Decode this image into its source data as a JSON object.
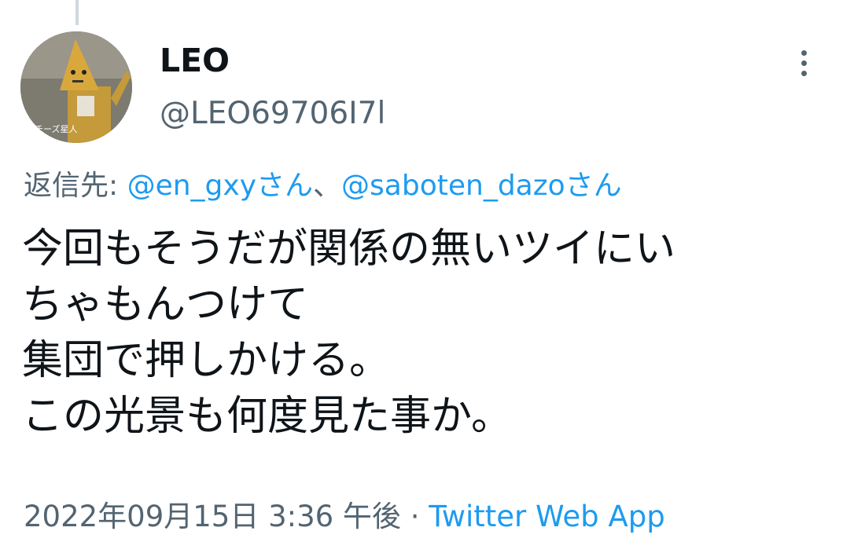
{
  "user": {
    "display_name": "LEO",
    "handle": "@LEO69706I7l",
    "avatar_caption": "チーズ星人"
  },
  "reply": {
    "prefix": "返信先:",
    "mention_1": "@en_gxyさん",
    "separator": "、",
    "mention_2": "@saboten_dazoさん"
  },
  "tweet": {
    "lines": [
      "今回もそうだが関係の無いツイにい",
      "ちゃもんつけて",
      "集団で押しかける。",
      "この光景も何度見た事か。"
    ]
  },
  "meta": {
    "datetime": "2022年09月15日 3:36 午後",
    "dot": "·",
    "source": "Twitter Web App"
  },
  "colors": {
    "link": "#1d9bf0",
    "secondary_text": "#536471",
    "primary_text": "#0f1419"
  },
  "icons": {
    "more": "more-vertical-icon"
  }
}
